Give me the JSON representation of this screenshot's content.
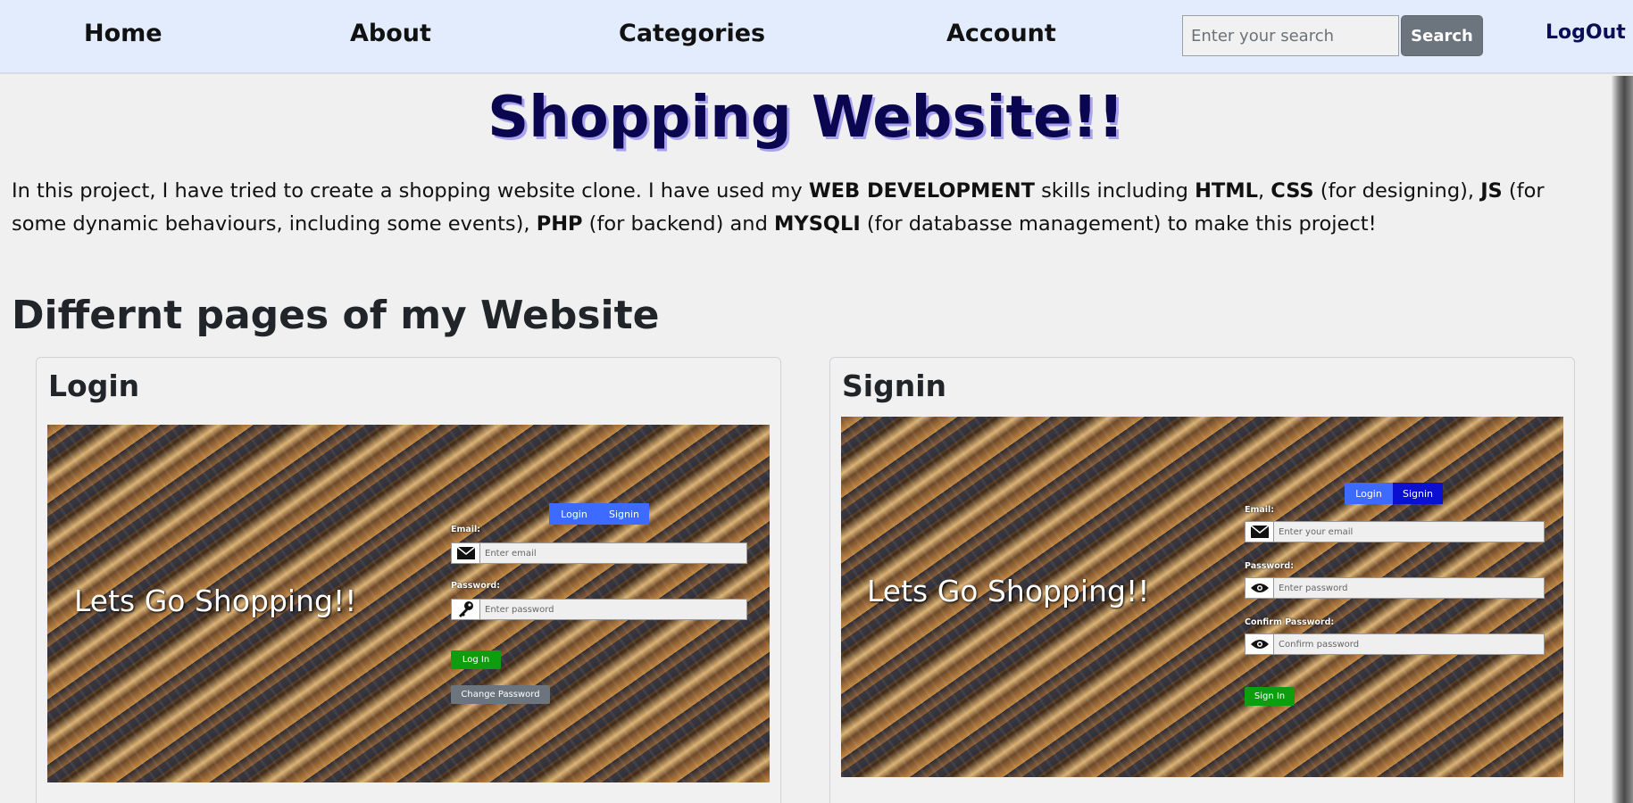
{
  "nav": {
    "home": "Home",
    "about": "About",
    "categories": "Categories",
    "account": "Account",
    "search_placeholder": "Enter your search",
    "search_button": "Search",
    "logout": "LogOut"
  },
  "main": {
    "title": "Shopping Website!!",
    "intro": {
      "p1": "In this project, I have tried to create a shopping website clone. I have used my ",
      "b1": "WEB DEVELOPMENT",
      "p2": " skills including ",
      "b2": "HTML",
      "p3": ", ",
      "b3": "CSS",
      "p4": " (for designing), ",
      "b4": "JS",
      "p5": " (for some dynamic behaviours, including some events), ",
      "b5": "PHP",
      "p6": " (for backend) and ",
      "b6": "MYSQLI",
      "p7": " (for databasse management) to make this project!"
    },
    "section_title": "Differnt pages of my Website"
  },
  "cards": {
    "login": {
      "title": "Login",
      "screenshot": {
        "headline": "Lets Go Shopping!!",
        "tab_login": "Login",
        "tab_signin": "Signin",
        "email_label": "Email:",
        "email_placeholder": "Enter email",
        "password_label": "Password:",
        "password_placeholder": "Enter password",
        "login_button": "Log In",
        "change_password_button": "Change Password"
      }
    },
    "signin": {
      "title": "Signin",
      "screenshot": {
        "headline": "Lets Go Shopping!!",
        "tab_login": "Login",
        "tab_signin": "Signin",
        "email_label": "Email:",
        "email_placeholder": "Enter your email",
        "password_label": "Password:",
        "password_placeholder": "Enter password",
        "confirm_label": "Confirm Password:",
        "confirm_placeholder": "Confirm password",
        "signin_button": "Sign In"
      }
    }
  },
  "colors": {
    "navbar_bg": "#e3ecfd",
    "title": "#0b0650",
    "title_shadow": "#a9a3ef",
    "search_button": "#6c757d",
    "logout": "#0a0f55",
    "mini_tab_blue": "#3d6bff",
    "mini_tab_active": "#0b0fd0",
    "mini_button_green": "#0f9d10"
  }
}
